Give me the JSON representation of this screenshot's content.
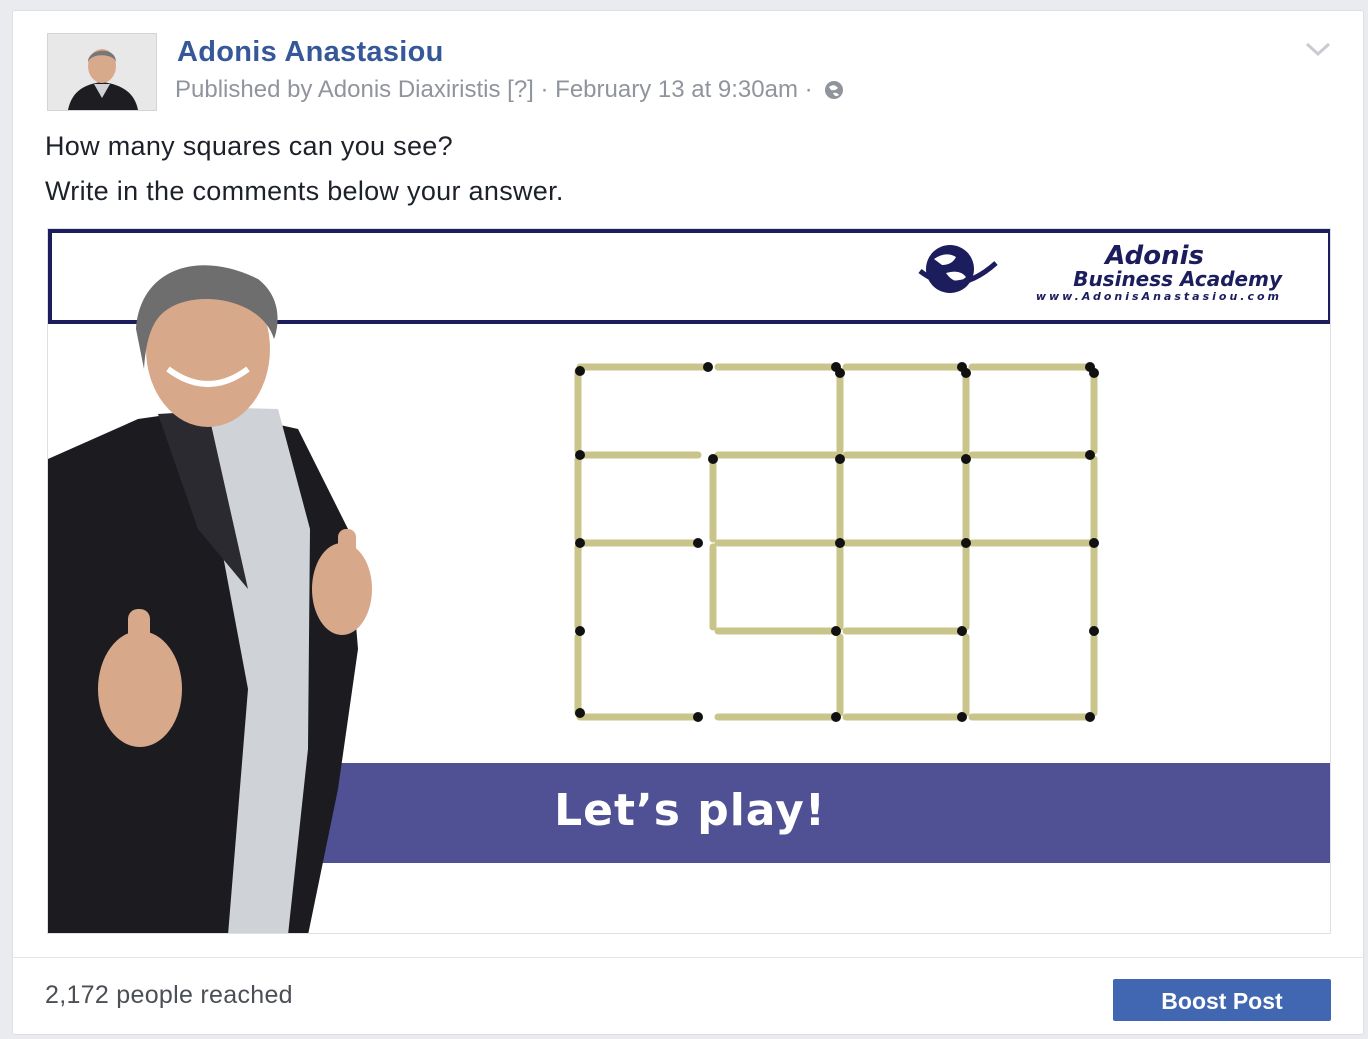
{
  "post": {
    "author": "Adonis Anastasiou",
    "meta": "Published by Adonis Diaxiristis [?] · February 13 at 9:30am · ",
    "line1": "How many squares can you see?",
    "line2": "Write in the comments below your answer."
  },
  "image": {
    "brand_line1": "Adonis",
    "brand_line2": "Business Academy",
    "brand_url": "www.AdonisAnastasiou.com",
    "cta": "Let’s play!"
  },
  "footer": {
    "reach": "2,172 people reached",
    "boost_label": "Boost Post"
  },
  "colors": {
    "link": "#365899",
    "boost": "#4267b2",
    "banner_bar": "#4f5194",
    "navy": "#1b1d5c"
  },
  "icons": [
    "avatar-photo",
    "globe-icon",
    "chevron-down-icon",
    "globe-logo-icon"
  ]
}
